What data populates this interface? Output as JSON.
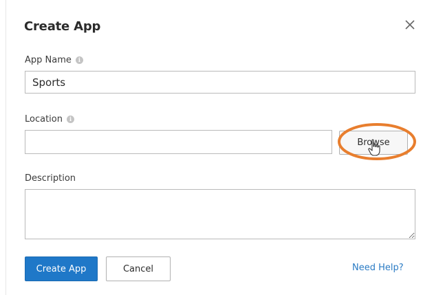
{
  "dialog": {
    "title": "Create App",
    "close_icon": "close-icon"
  },
  "form": {
    "app_name": {
      "label": "App Name",
      "value": "Sports",
      "info_icon": "info-icon"
    },
    "location": {
      "label": "Location",
      "value": "",
      "info_icon": "info-icon",
      "browse_label": "Browse"
    },
    "description": {
      "label": "Description",
      "value": ""
    }
  },
  "footer": {
    "create_label": "Create App",
    "cancel_label": "Cancel",
    "help_label": "Need Help?"
  },
  "annotation": {
    "highlight_color": "#e87e2e",
    "cursor_icon": "hand-pointer-icon"
  },
  "colors": {
    "primary": "#1f78c8",
    "link": "#2a7bc4"
  }
}
